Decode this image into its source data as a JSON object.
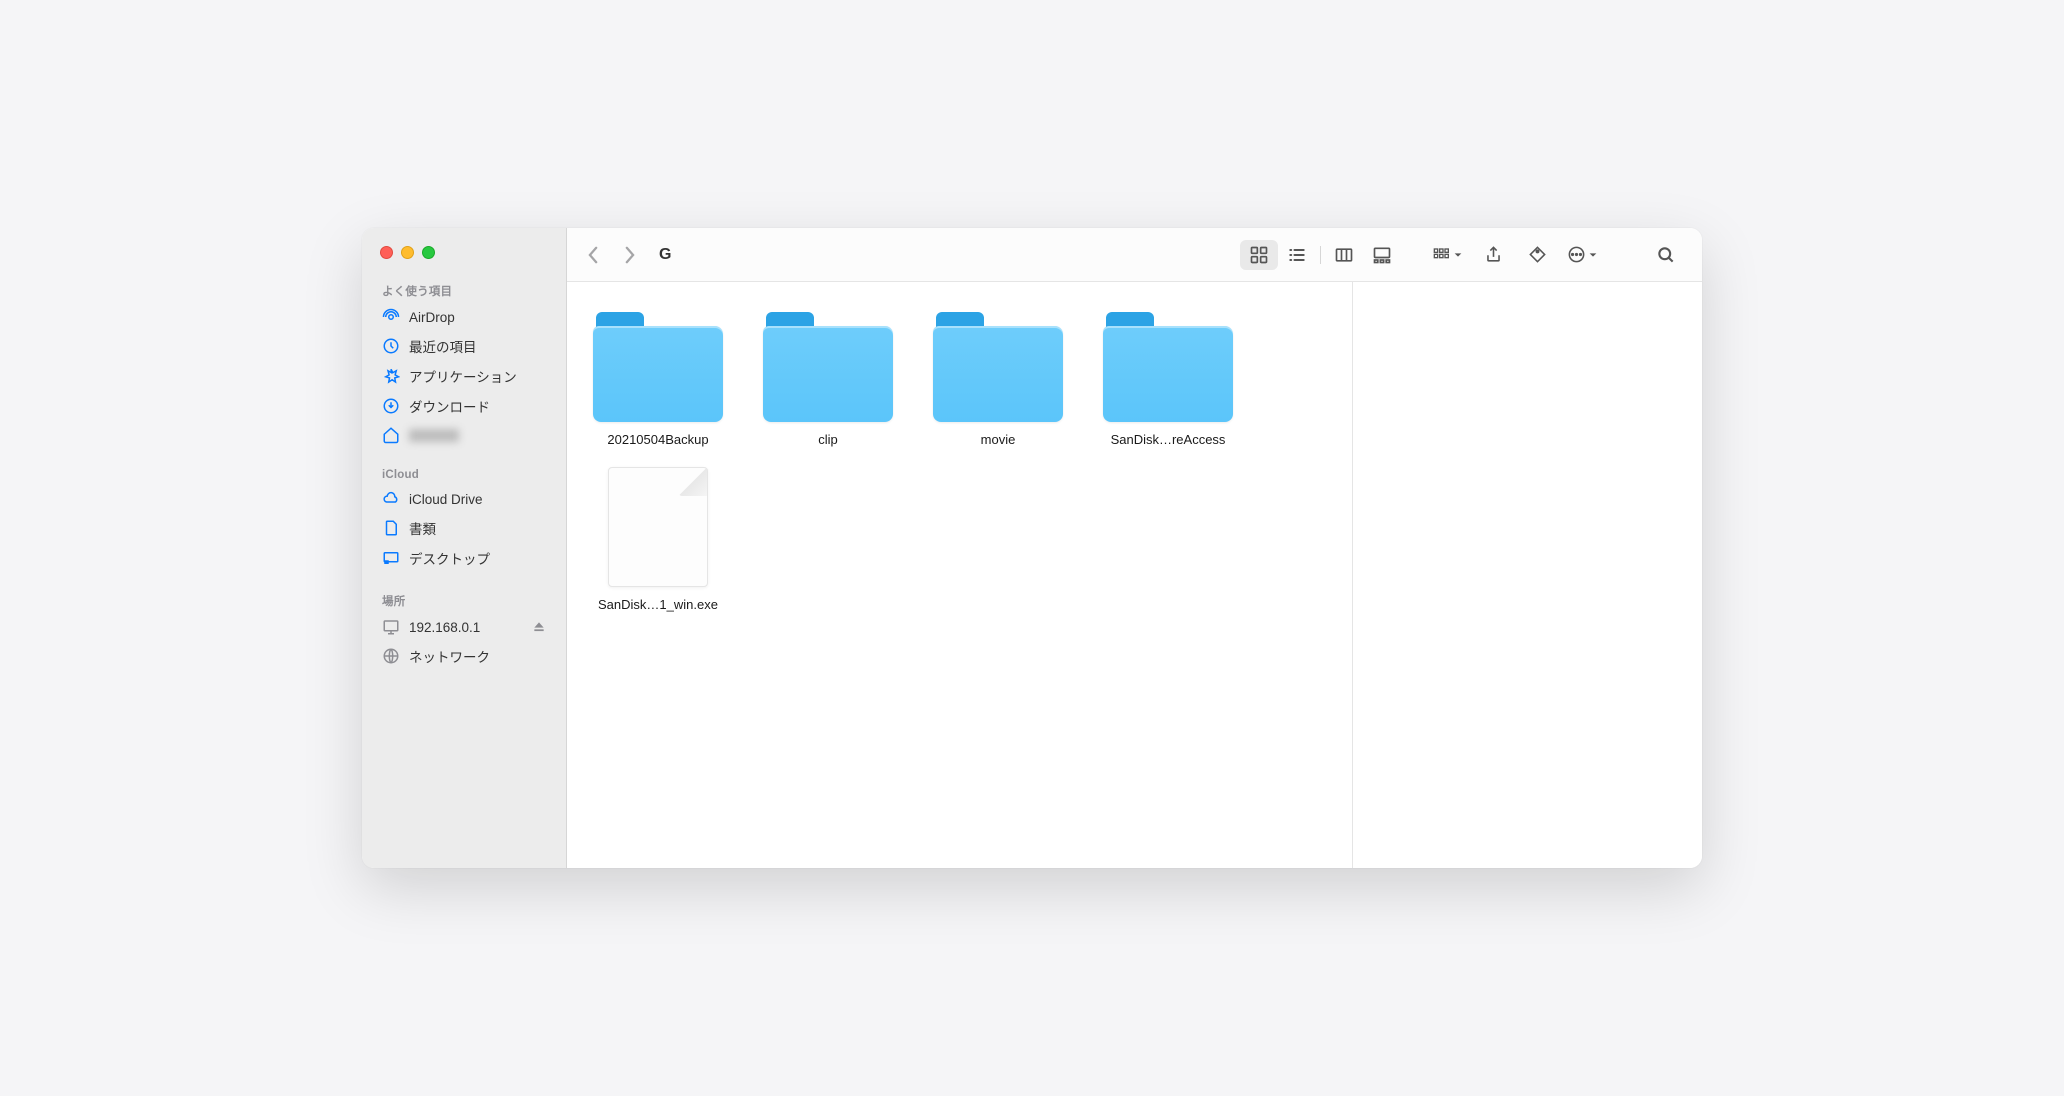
{
  "window": {
    "title": "G"
  },
  "sidebar": {
    "sections": {
      "favorites": {
        "header": "よく使う項目",
        "items": [
          {
            "label": "AirDrop",
            "icon": "airdrop"
          },
          {
            "label": "最近の項目",
            "icon": "clock"
          },
          {
            "label": "アプリケーション",
            "icon": "apps"
          },
          {
            "label": "ダウンロード",
            "icon": "download"
          },
          {
            "label": "",
            "icon": "home",
            "blurred": true
          }
        ]
      },
      "icloud": {
        "header": "iCloud",
        "items": [
          {
            "label": "iCloud Drive",
            "icon": "cloud"
          },
          {
            "label": "書類",
            "icon": "document"
          },
          {
            "label": "デスクトップ",
            "icon": "desktop"
          }
        ]
      },
      "locations": {
        "header": "場所",
        "items": [
          {
            "label": "192.168.0.1",
            "icon": "monitor",
            "eject": true
          },
          {
            "label": "ネットワーク",
            "icon": "globe"
          }
        ]
      }
    }
  },
  "files": [
    {
      "name": "20210504Backup",
      "type": "folder"
    },
    {
      "name": "clip",
      "type": "folder"
    },
    {
      "name": "movie",
      "type": "folder"
    },
    {
      "name": "SanDisk…reAccess",
      "type": "folder"
    },
    {
      "name": "SanDisk…1_win.exe",
      "type": "file"
    }
  ]
}
